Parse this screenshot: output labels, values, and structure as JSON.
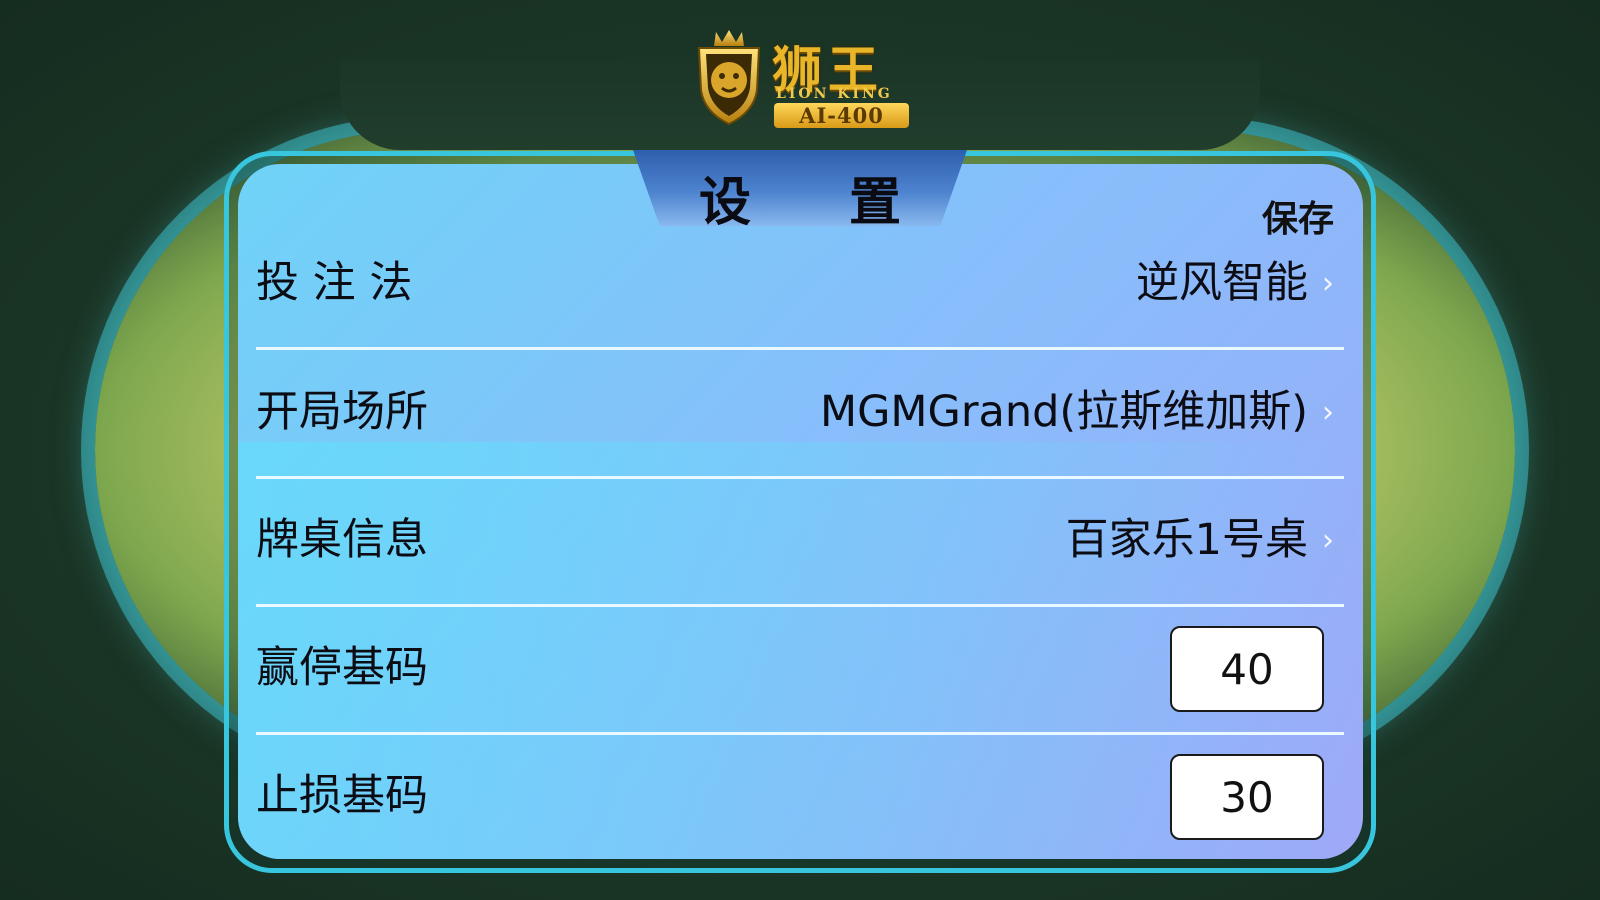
{
  "logo": {
    "cn": "狮王",
    "en": "LION KING",
    "model": "AI-400"
  },
  "header": {
    "title": "设 置",
    "save_label": "保存"
  },
  "rows": [
    {
      "label": "投 注 法",
      "value": "逆风智能"
    },
    {
      "label": "开局场所",
      "value": "MGMGrand(拉斯维加斯)"
    },
    {
      "label": "牌桌信息",
      "value": "百家乐1号桌"
    },
    {
      "label": "赢停基码",
      "input_value": "40"
    },
    {
      "label": "止损基码",
      "input_value": "30"
    }
  ],
  "chevron_glyph": "›"
}
